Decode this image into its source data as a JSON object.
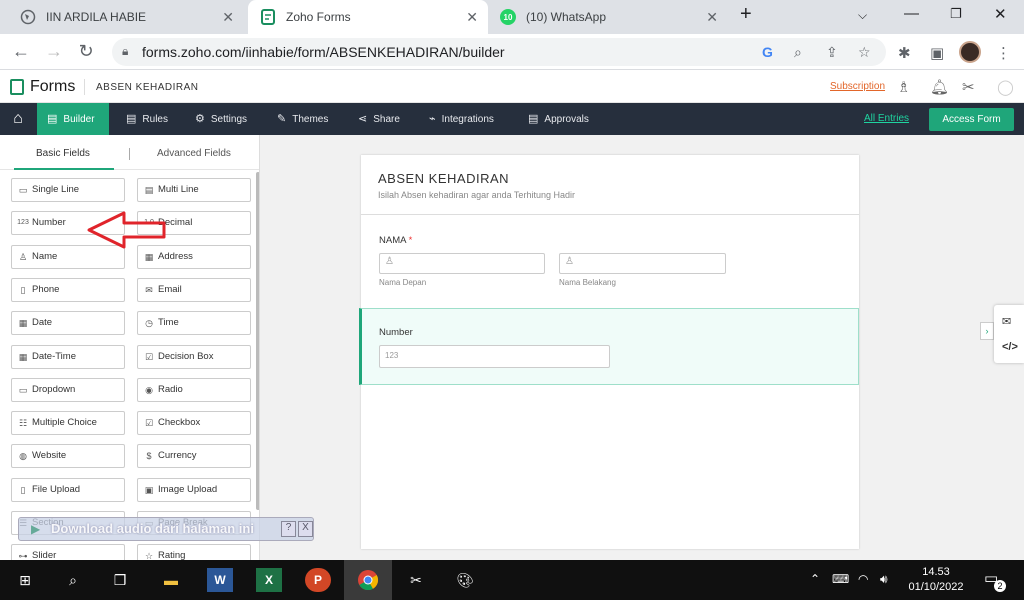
{
  "browser": {
    "tabs": [
      {
        "title": "IIN ARDILA HABIE",
        "active": false
      },
      {
        "title": "Zoho Forms",
        "active": true
      },
      {
        "title": "(10) WhatsApp",
        "active": false,
        "badge": "10"
      }
    ],
    "url": "forms.zoho.com/iinhabie/form/ABSENKEHADIRAN/builder"
  },
  "app": {
    "brand": "Forms",
    "form_name": "ABSEN KEHADIRAN",
    "subscription_label": "Subscription"
  },
  "toolbar": {
    "items": [
      {
        "label": "Builder",
        "icon": "builder-icon"
      },
      {
        "label": "Rules",
        "icon": "rules-icon"
      },
      {
        "label": "Settings",
        "icon": "gear-icon"
      },
      {
        "label": "Themes",
        "icon": "brush-icon"
      },
      {
        "label": "Share",
        "icon": "share-icon"
      },
      {
        "label": "Integrations",
        "icon": "plug-icon"
      },
      {
        "label": "Approvals",
        "icon": "approval-icon"
      }
    ],
    "all_entries": "All Entries",
    "access_form": "Access Form"
  },
  "fields_panel": {
    "tabs": [
      "Basic Fields",
      "Advanced Fields"
    ],
    "fields": [
      {
        "label": "Single Line",
        "icon": "▭"
      },
      {
        "label": "Multi Line",
        "icon": "▤"
      },
      {
        "label": "Number",
        "icon": "123"
      },
      {
        "label": "Decimal",
        "icon": "1.0"
      },
      {
        "label": "Name",
        "icon": "♙"
      },
      {
        "label": "Address",
        "icon": "▦"
      },
      {
        "label": "Phone",
        "icon": "▯"
      },
      {
        "label": "Email",
        "icon": "✉"
      },
      {
        "label": "Date",
        "icon": "▦"
      },
      {
        "label": "Time",
        "icon": "◷"
      },
      {
        "label": "Date-Time",
        "icon": "▦"
      },
      {
        "label": "Decision Box",
        "icon": "☑"
      },
      {
        "label": "Dropdown",
        "icon": "▭"
      },
      {
        "label": "Radio",
        "icon": "◉"
      },
      {
        "label": "Multiple Choice",
        "icon": "☷"
      },
      {
        "label": "Checkbox",
        "icon": "☑"
      },
      {
        "label": "Website",
        "icon": "◍"
      },
      {
        "label": "Currency",
        "icon": "$"
      },
      {
        "label": "File Upload",
        "icon": "▯"
      },
      {
        "label": "Image Upload",
        "icon": "▣"
      },
      {
        "label": "Section",
        "icon": "☰"
      },
      {
        "label": "Page Break",
        "icon": "▭"
      },
      {
        "label": "Slider",
        "icon": "⊶"
      },
      {
        "label": "Rating",
        "icon": "☆"
      }
    ]
  },
  "audio_popup": {
    "text": "Download audio dari halaman ini",
    "help": "?",
    "close": "X"
  },
  "form": {
    "title": "ABSEN KEHADIRAN",
    "description": "Isilah Absen kehadiran agar anda Terhitung Hadir",
    "name_field": {
      "label": "NAMA",
      "required_mark": "*",
      "first_label": "Nama Depan",
      "last_label": "Nama Belakang"
    },
    "number_field": {
      "label": "Number",
      "placeholder": "123"
    }
  },
  "taskbar": {
    "time": "14.53",
    "date": "01/10/2022",
    "notification_count": "2"
  }
}
